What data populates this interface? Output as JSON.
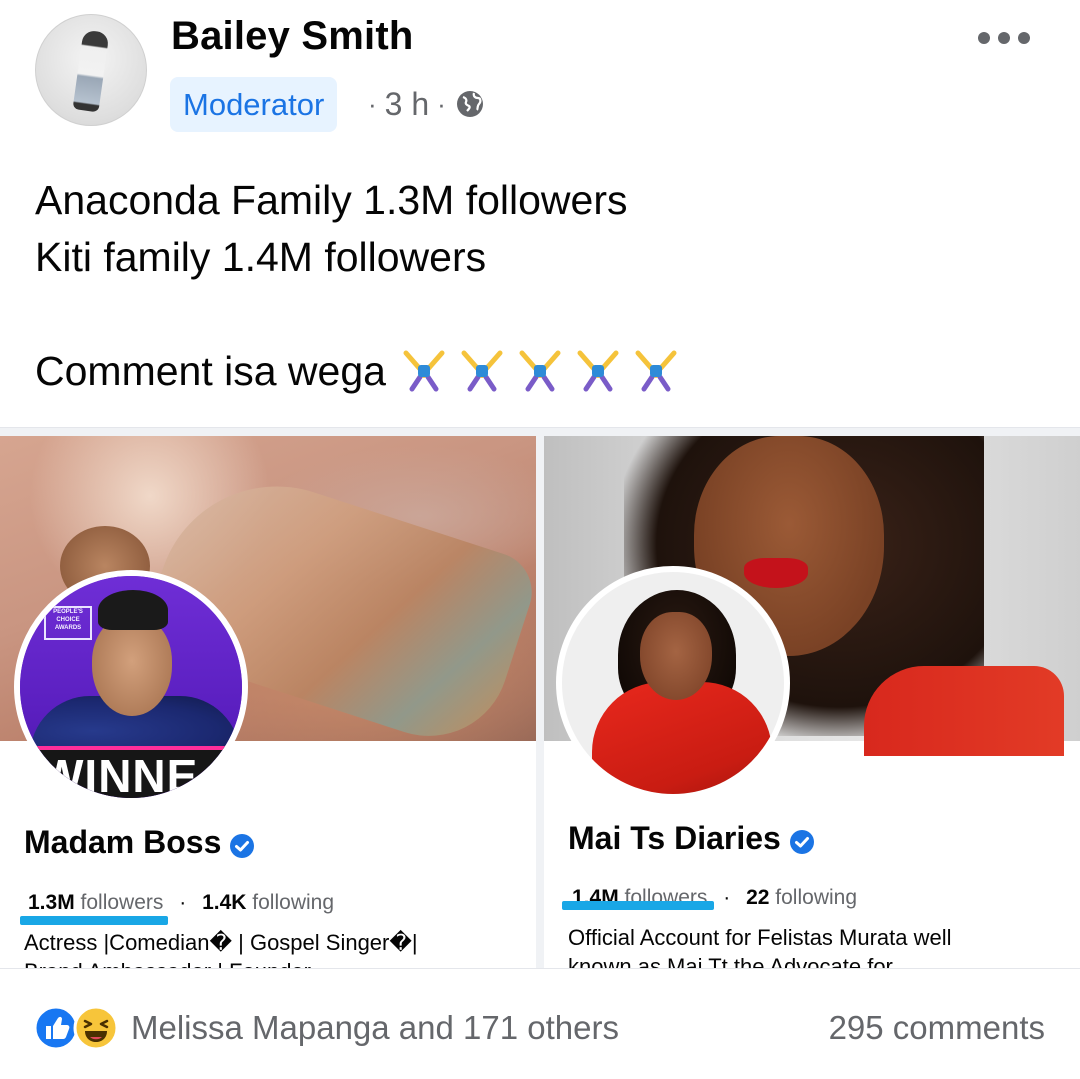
{
  "post": {
    "author": "Bailey Smith",
    "role_badge": "Moderator",
    "time": "3 h",
    "separator": "·",
    "privacy_icon": "globe-icon",
    "more_icon": "more-options-icon",
    "text_lines": [
      "Anaconda Family 1.3M followers",
      "Kiti family 1.4M followers",
      "",
      "Comment isa wega"
    ],
    "emoji": "person-cartwheeling-icon",
    "emoji_count": 5
  },
  "images": {
    "left": {
      "page_name": "Madam Boss",
      "followers_count": "1.3M",
      "followers_label": "followers",
      "following_count": "1.4K",
      "following_label": "following",
      "bio_line1": "Actress |Comedian� | Gospel Singer�|",
      "bio_line2": "Brand Ambassador | Founder",
      "badge_text": "WINNE",
      "award_text": "PEOPLE'S CHOICE AWARDS"
    },
    "right": {
      "page_name": "Mai Ts Diaries",
      "followers_count": "1.4M",
      "followers_label": "followers",
      "following_count": "22",
      "following_label": "following",
      "bio_line1": "Official Account for Felistas Murata well",
      "bio_line2": "known as Mai Tt the Advocate for"
    },
    "stat_separator": "·",
    "underline_color": "#19a7e6"
  },
  "footer": {
    "reactions_text": "Melissa Mapanga and 171 others",
    "reaction_icons": [
      "like-icon",
      "haha-icon"
    ],
    "comments": "295 comments"
  },
  "colors": {
    "badge_bg": "#e7f3ff",
    "badge_text": "#1b74e4",
    "meta_text": "#65676b",
    "like_blue": "#1877f2",
    "verified_blue": "#1b74e4"
  }
}
